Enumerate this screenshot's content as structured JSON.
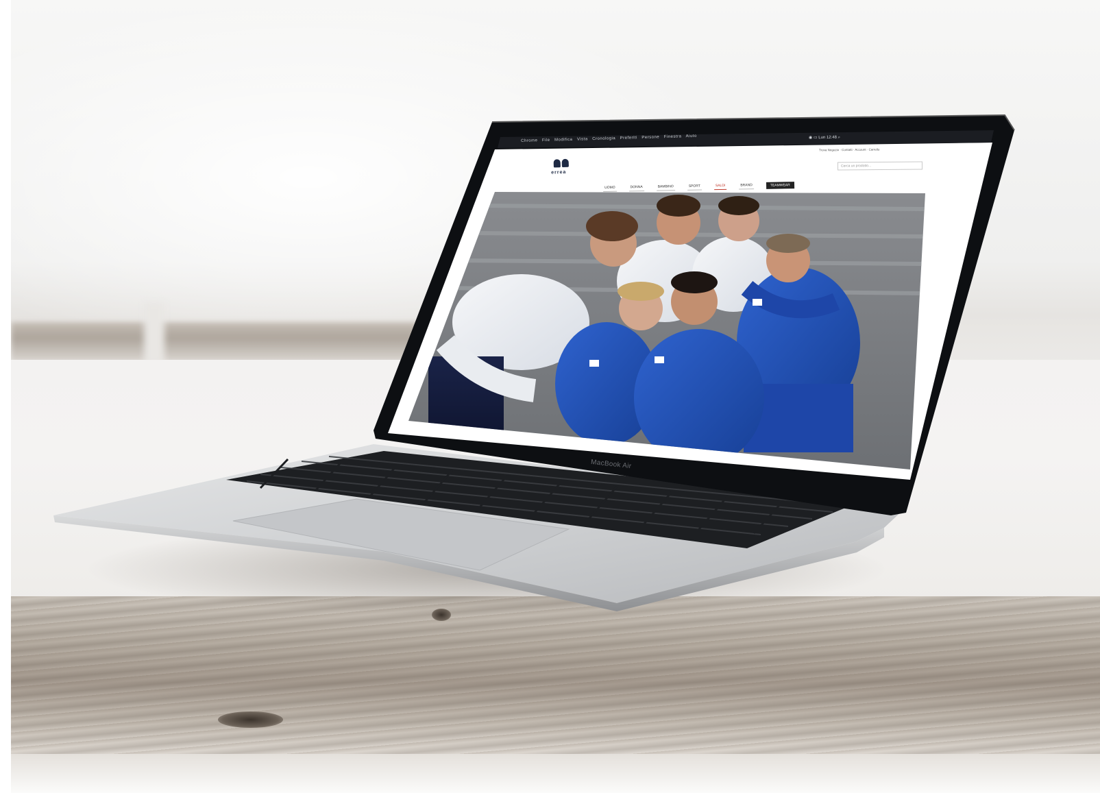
{
  "scene": {
    "description_tag": "laptop-on-wooden-table",
    "device_label": "MacBook Air",
    "colors": {
      "bezel": "#0d0f12",
      "aluminium": "#c9cbcd",
      "jersey_blue": "#1f4fb3",
      "table_wood": "#b5aca1"
    }
  },
  "website": {
    "logo_text": "errea",
    "menubar_items": [
      "Chrome",
      "File",
      "Modifica",
      "Vista",
      "Cronologia",
      "Preferiti",
      "Persone",
      "Finestra",
      "Aiuto"
    ],
    "status_time": "Lun 12:48",
    "top_links": [
      "Trova Negozio",
      "Contatti",
      "Account",
      "Carrello"
    ],
    "search_placeholder": "Cerca un prodotto...",
    "nav_items": [
      {
        "label": "UOMO"
      },
      {
        "label": "DONNA"
      },
      {
        "label": "BAMBINO"
      },
      {
        "label": "SPORT"
      },
      {
        "label": "SALDI"
      },
      {
        "label": "BRAND"
      },
      {
        "label": "TEAMWEAR"
      }
    ]
  }
}
